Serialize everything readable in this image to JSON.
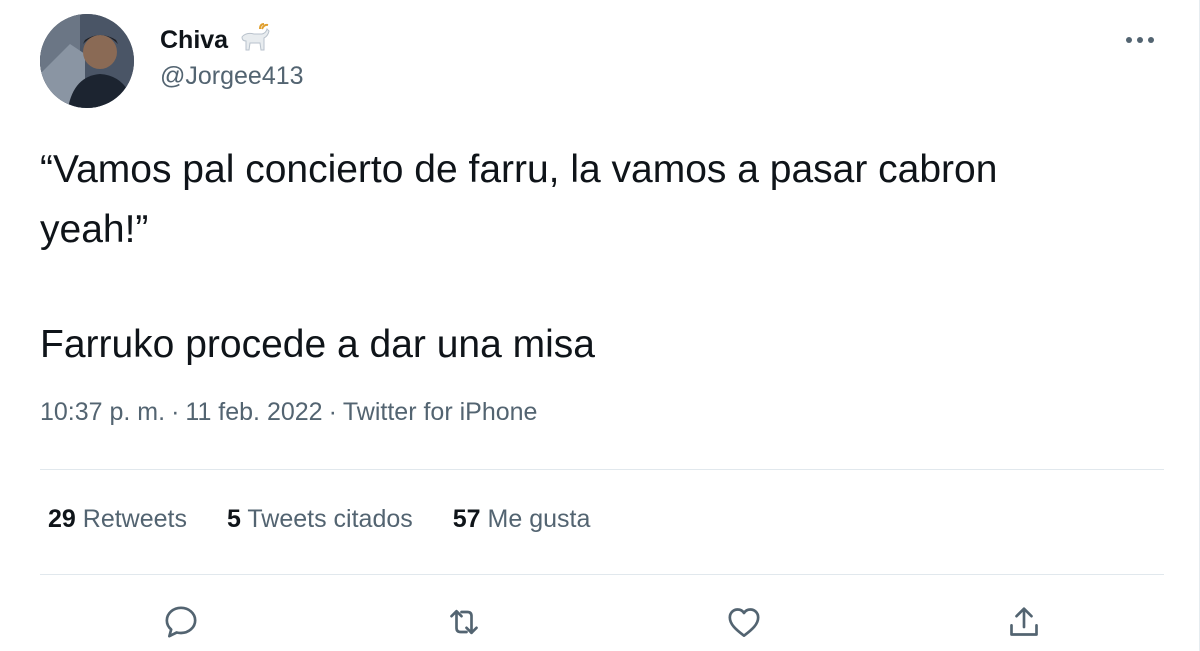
{
  "author": {
    "display_name": "Chiva",
    "handle": "@Jorgee413",
    "name_emoji_icon": "goat-icon",
    "avatar_icon": "user-avatar-photo"
  },
  "tweet": {
    "line1": "“Vamos pal concierto de farru, la vamos a pasar cabron yeah!”",
    "line2": "Farruko procede a dar una misa"
  },
  "meta": {
    "time": "10:37 p. m.",
    "separator": "·",
    "date": "11 feb. 2022",
    "source": "Twitter for iPhone"
  },
  "stats": {
    "retweets_count": "29",
    "retweets_label": "Retweets",
    "quotes_count": "5",
    "quotes_label": "Tweets citados",
    "likes_count": "57",
    "likes_label": "Me gusta"
  },
  "actions": [
    "reply-icon",
    "retweet-icon",
    "like-icon",
    "share-icon"
  ],
  "colors": {
    "text_primary": "#0f1419",
    "text_secondary": "#536471",
    "divider": "#e1e8ed"
  }
}
